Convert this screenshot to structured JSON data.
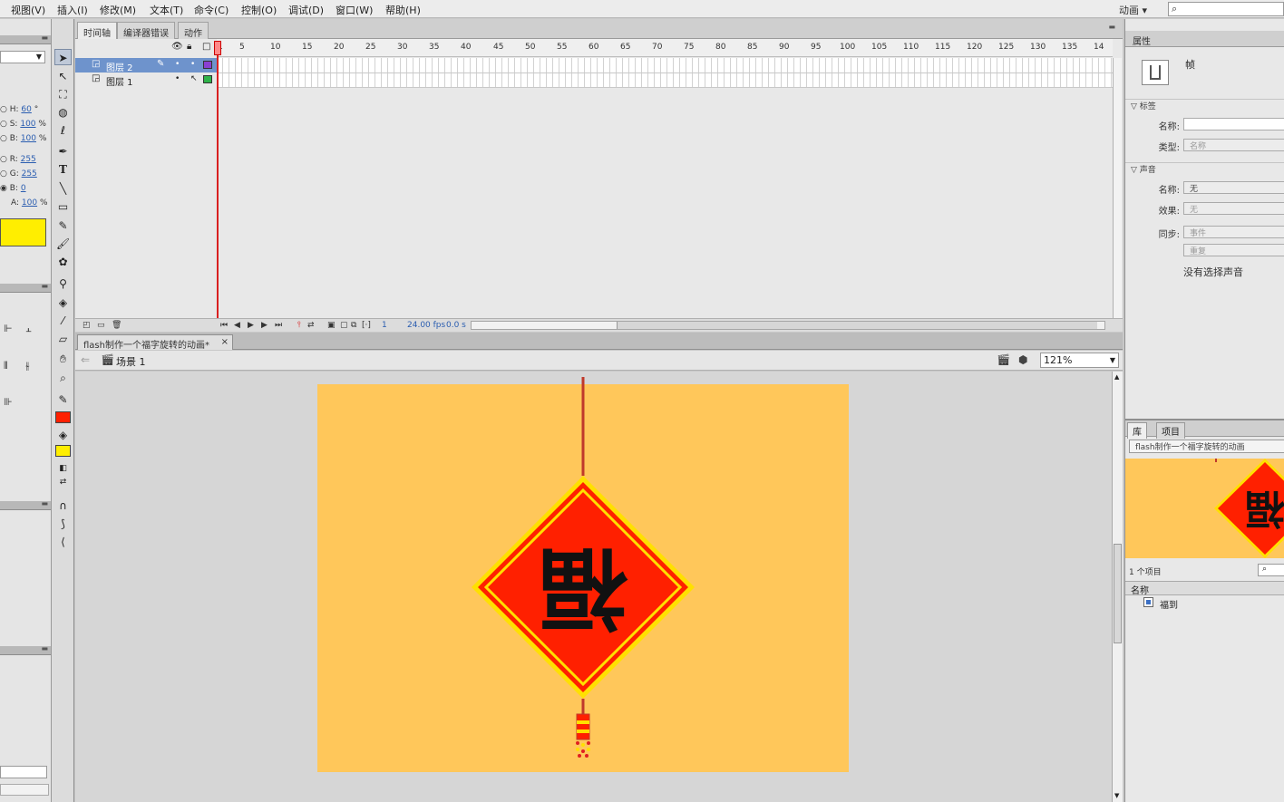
{
  "menu": [
    "视图(V)",
    "插入(I)",
    "修改(M)",
    "文本(T)",
    "命令(C)",
    "控制(O)",
    "调试(D)",
    "窗口(W)",
    "帮助(H)"
  ],
  "workspace_mode": "动画",
  "color_panel": {
    "rows": [
      {
        "label": "H:",
        "value": "60",
        "unit": "°"
      },
      {
        "label": "S:",
        "value": "100",
        "unit": "%"
      },
      {
        "label": "B:",
        "value": "100",
        "unit": "%"
      },
      {
        "label": "R:",
        "value": "255",
        "unit": ""
      },
      {
        "label": "G:",
        "value": "255",
        "unit": ""
      },
      {
        "label": "B:",
        "value": "0",
        "unit": ""
      },
      {
        "label": "A:",
        "value": "100",
        "unit": "%"
      }
    ],
    "swatch_color": "#ffee00"
  },
  "timeline": {
    "tabs": [
      "时间轴",
      "编译器错误",
      "动作"
    ],
    "ruler": [
      "1",
      "5",
      "10",
      "15",
      "20",
      "25",
      "30",
      "35",
      "40",
      "45",
      "50",
      "55",
      "60",
      "65",
      "70",
      "75",
      "80",
      "85",
      "90",
      "95",
      "100",
      "105",
      "110",
      "115",
      "120",
      "125",
      "130",
      "135",
      "14"
    ],
    "layers": [
      {
        "name": "图层 2",
        "selected": true,
        "outline_color": "#8a3fd1"
      },
      {
        "name": "图层 1",
        "selected": false,
        "outline_color": "#2fb34a"
      }
    ],
    "footer": {
      "frame": "1",
      "fps": "24.00 fps",
      "time": "0.0 s"
    }
  },
  "document": {
    "tab_title": "flash制作一个福字旋转的动画*",
    "tab_close": "×",
    "scene": "场景 1",
    "zoom": "121%",
    "stage_color": "#ffc75a",
    "ornament": {
      "glyph": "福",
      "fill": "#ff2000",
      "border": "#ffe000",
      "text_color": "#111111",
      "rotation_deg": 180
    }
  },
  "properties": {
    "tab": "属性",
    "frame_label": "帧",
    "sections": {
      "label": "标签",
      "sound": "声音"
    },
    "fields": {
      "label_name": {
        "label": "名称:",
        "value": ""
      },
      "label_type": {
        "label": "类型:",
        "value": "名称"
      },
      "sound_name": {
        "label": "名称:",
        "value": "无"
      },
      "effect": {
        "label": "效果:",
        "value": "无"
      },
      "sync": {
        "label": "同步:",
        "value": "事件"
      },
      "repeat": {
        "label": "",
        "value": "重复"
      }
    },
    "no_sound": "没有选择声音"
  },
  "library": {
    "tabs": [
      "库",
      "项目"
    ],
    "document": "flash制作一个福字旋转的动画",
    "count": "1 个项目",
    "name_header": "名称",
    "items": [
      "福到"
    ]
  }
}
